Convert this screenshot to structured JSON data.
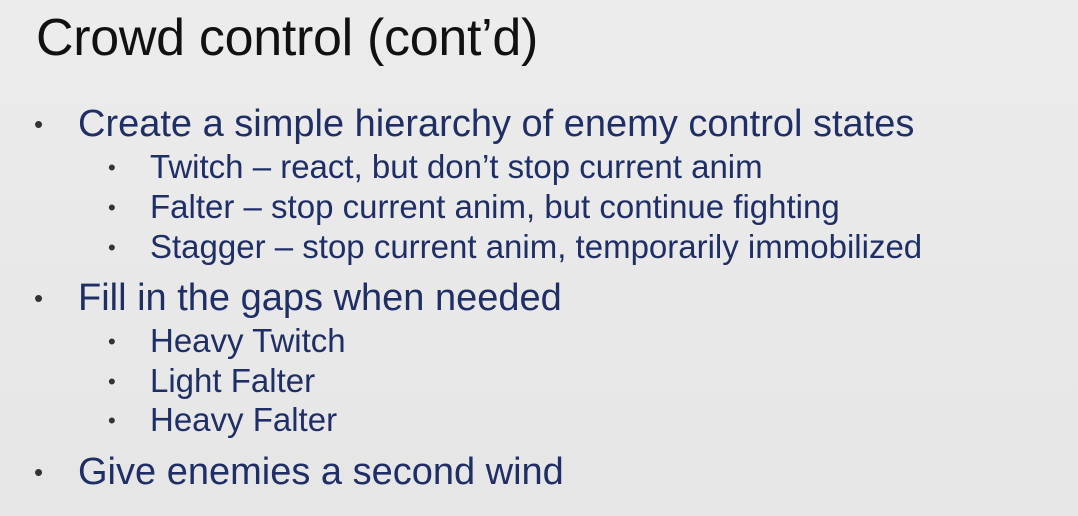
{
  "slide": {
    "title": "Crowd control (cont’d)",
    "bullets": [
      {
        "text": "Create a simple hierarchy of enemy control states",
        "children": [
          "Twitch – react, but don’t stop current anim",
          "Falter – stop current anim, but continue fighting",
          "Stagger – stop current anim, temporarily immobilized"
        ]
      },
      {
        "text": "Fill in the gaps when needed",
        "children": [
          "Heavy Twitch",
          "Light Falter",
          "Heavy Falter"
        ]
      },
      {
        "text": "Give enemies a second wind",
        "children": []
      }
    ]
  },
  "colors": {
    "background": "#e9e9e9",
    "title": "#111111",
    "bullet_text": "#1f2f66",
    "bullet_dot": "#333333"
  }
}
